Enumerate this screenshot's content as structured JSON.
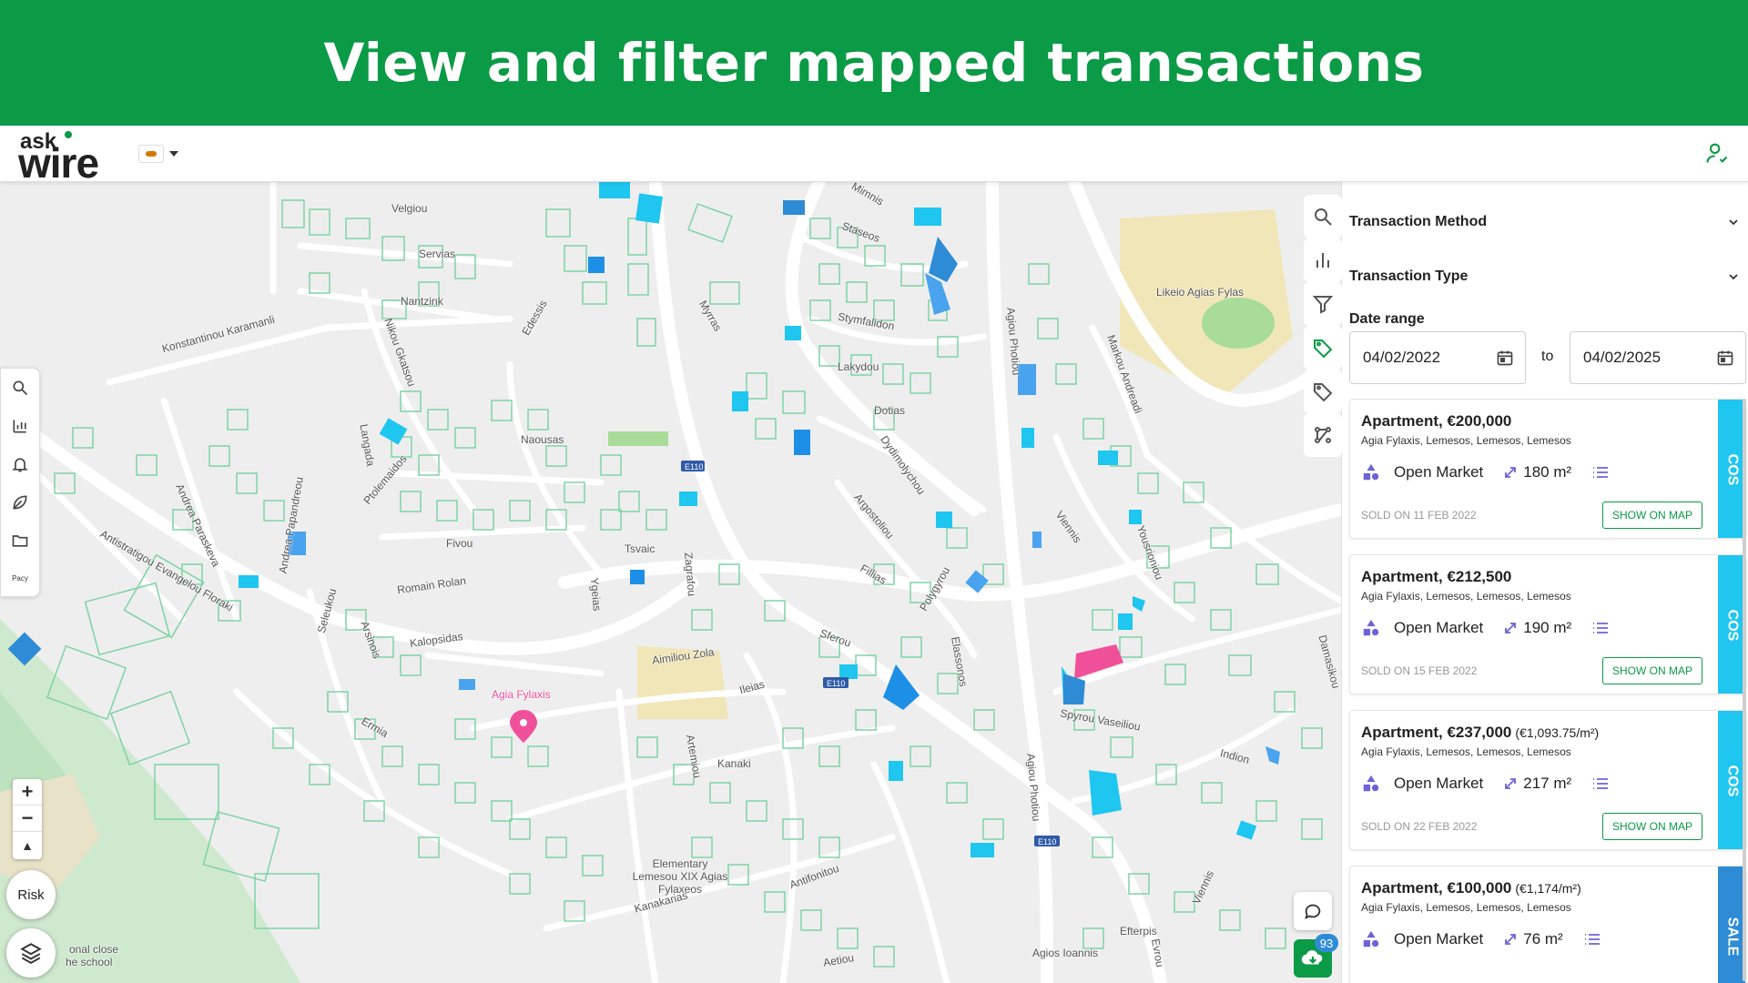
{
  "banner": {
    "title": "View and filter mapped transactions"
  },
  "app": {
    "logo_top": "ask",
    "logo_main": "wire"
  },
  "map": {
    "labels": [
      "Velgiou",
      "Servias",
      "Nantzink",
      "Konstantinou Karamanli",
      "Nikou Gkatsou",
      "Edessis",
      "Myrras",
      "Mimnis",
      "Staseos",
      "Stymfalidon",
      "Lakydou",
      "Dotias",
      "Naousas",
      "Langada",
      "Ptolemaidos",
      "Andrea Paraskeva",
      "Andrea Papandreou",
      "Antistratigou Evangelou Floraki",
      "Fivou",
      "Romain Rolan",
      "Tsvaic",
      "Ygeias",
      "Zagrafou",
      "Dydimolychou",
      "Argostoliou",
      "Fillias",
      "Polygyrou",
      "Sferou",
      "Seleukou",
      "Arsinois",
      "Kalopsidas",
      "Agia Fylaxis",
      "Aimiliou Zola",
      "Ileias",
      "E110",
      "E110",
      "E110",
      "Ermia",
      "Artemiou",
      "Kanaki",
      "Elementary Lemesou XIX Agias Fylaxeos",
      "Kanakarias",
      "Antifonitou",
      "Aetiou",
      "Elassonos",
      "Agiou Photiou",
      "Agiou Photiou",
      "Spyrou Vaseiliou",
      "Indion",
      "Markou Andreadi",
      "Likeio Agias Fylas",
      "Viennis",
      "Yousrioniou",
      "Damasikou",
      "Viennis",
      "Efterpis",
      "Agios Ioannis",
      "Evrou",
      "onal close",
      "he school"
    ],
    "risk_label": "Risk",
    "badge_count": "93"
  },
  "left_tools": {
    "pacy_label": "Pacy"
  },
  "panel": {
    "transaction_method": "Transaction Method",
    "transaction_type": "Transaction Type",
    "date_range_label": "Date range",
    "date_from": "04/02/2022",
    "date_to": "04/02/2025",
    "to_label": "to",
    "cards": [
      {
        "title": "Apartment, €200,000",
        "ppm": "",
        "location": "Agia Fylaxis, Lemesos, Lemesos, Lemesos",
        "market": "Open Market",
        "area": "180 m²",
        "sold": "SOLD ON 11 FEB 2022",
        "show": "SHOW ON MAP",
        "tag": "COS"
      },
      {
        "title": "Apartment, €212,500",
        "ppm": "",
        "location": "Agia Fylaxis, Lemesos, Lemesos, Lemesos",
        "market": "Open Market",
        "area": "190 m²",
        "sold": "SOLD ON 15 FEB 2022",
        "show": "SHOW ON MAP",
        "tag": "COS"
      },
      {
        "title": "Apartment, €237,000",
        "ppm": "(€1,093.75/m²)",
        "location": "Agia Fylaxis, Lemesos, Lemesos, Lemesos",
        "market": "Open Market",
        "area": "217 m²",
        "sold": "SOLD ON 22 FEB 2022",
        "show": "SHOW ON MAP",
        "tag": "COS"
      },
      {
        "title": "Apartment, €100,000",
        "ppm": "(€1,174/m²)",
        "location": "Agia Fylaxis, Lemesos, Lemesos, Lemesos",
        "market": "Open Market",
        "area": "76 m²",
        "sold": "",
        "show": "",
        "tag": "SALE"
      }
    ]
  },
  "colors": {
    "brand_green": "#0b9a45",
    "cos_tag": "#1ec6f0",
    "sale_tag": "#2e8bd6",
    "parcel_outline": "#7fd3a6",
    "highlight_pink": "#f0509a"
  }
}
